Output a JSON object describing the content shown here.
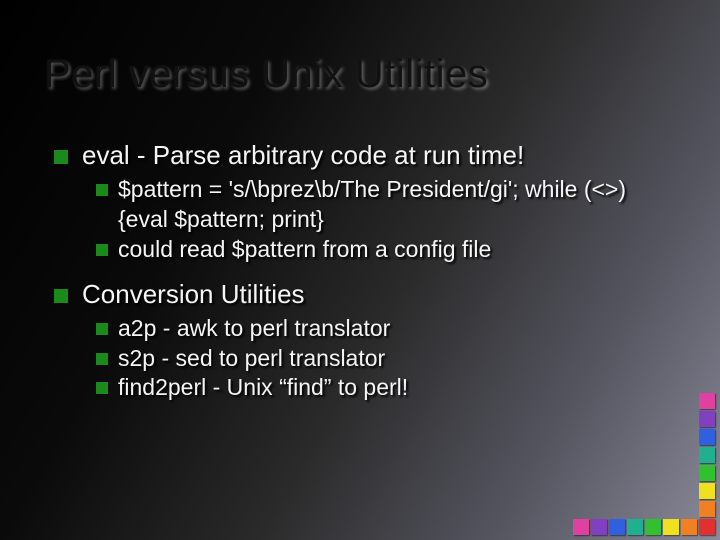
{
  "title": "Perl versus Unix Utilities",
  "items": [
    {
      "text": "eval - Parse arbitrary code at run time!",
      "sub": [
        {
          "text": "$pattern = 's/\\bprez\\b/The President/gi'; while (<>) {eval $pattern; print}"
        },
        {
          "text": "could read $pattern from a config file"
        }
      ]
    },
    {
      "text": "Conversion Utilities",
      "sub": [
        {
          "text": "a2p - awk to perl translator"
        },
        {
          "text": "s2p - sed to perl translator"
        },
        {
          "text": "find2perl - Unix “find” to perl!"
        }
      ]
    }
  ]
}
